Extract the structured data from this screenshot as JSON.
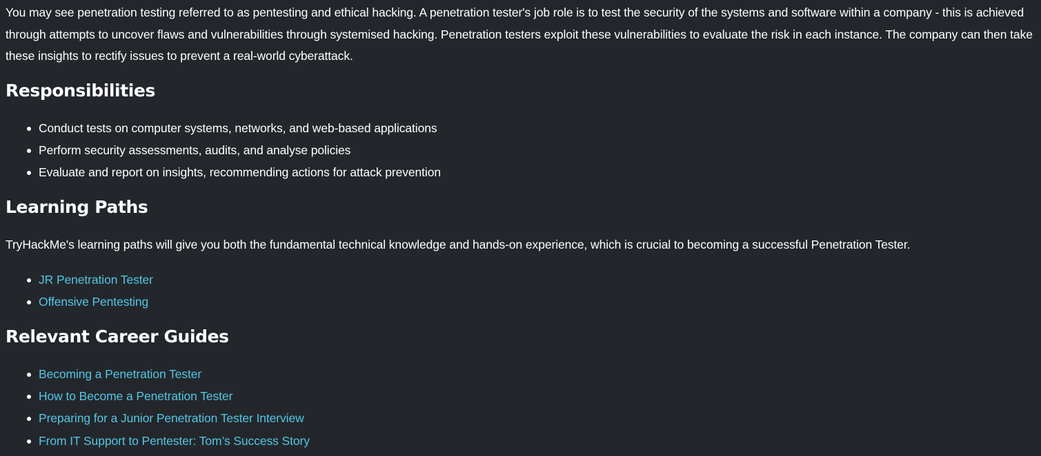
{
  "intro": {
    "text": "You may see penetration testing referred to as pentesting and ethical hacking. A penetration tester's job role is to test the security of the systems and software within a company - this is achieved through attempts to uncover flaws and vulnerabilities through systemised hacking. Penetration testers exploit these vulnerabilities to evaluate the risk in each instance. The company can then take these insights to rectify issues to prevent a real-world cyberattack."
  },
  "responsibilities": {
    "heading": "Responsibilities",
    "items": [
      "Conduct tests on computer systems, networks, and web-based applications",
      "Perform security assessments, audits, and analyse policies",
      "Evaluate and report on insights, recommending actions for attack prevention"
    ]
  },
  "learning_paths": {
    "heading": "Learning Paths",
    "description": "TryHackMe's learning paths will give you both the fundamental technical knowledge and hands-on experience, which is crucial to becoming a successful Penetration Tester.",
    "links": [
      "JR Penetration Tester",
      "Offensive Pentesting"
    ]
  },
  "career_guides": {
    "heading": "Relevant Career Guides",
    "links": [
      "Becoming a Penetration Tester",
      "How to Become a Penetration Tester",
      "Preparing for a Junior Penetration Tester Interview",
      "From IT Support to Pentester: Tom’s Success Story"
    ]
  },
  "colors": {
    "background": "#23272c",
    "text": "#ffffff",
    "link": "#54c6e3"
  }
}
